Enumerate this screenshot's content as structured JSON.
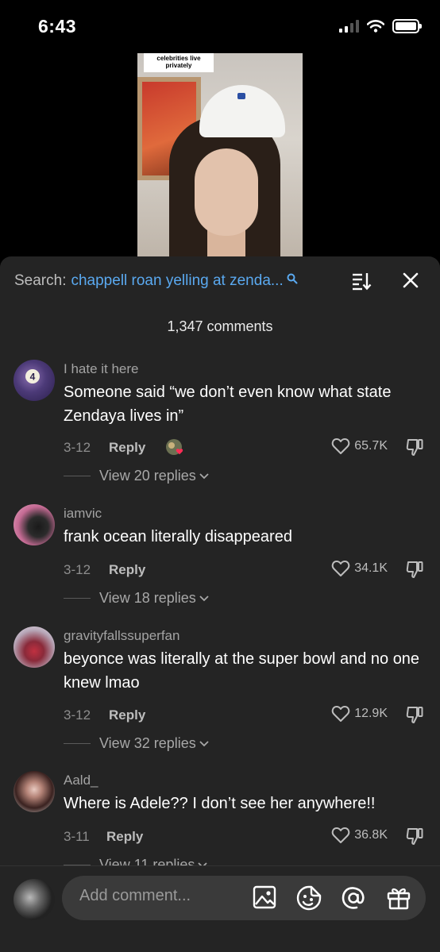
{
  "status_bar": {
    "time": "6:43"
  },
  "video": {
    "caption": "celebrities live privately"
  },
  "search": {
    "label": "Search:",
    "query": "chappell roan yelling at zenda..."
  },
  "comment_count": "1,347 comments",
  "comments": [
    {
      "username": "I hate it here",
      "text": "Someone said “we don’t even know what state Zendaya lives in”",
      "date": "3-12",
      "reply": "Reply",
      "likes": "65.7K",
      "view_replies": "View 20 replies",
      "creator_liked": true
    },
    {
      "username": "iamvic",
      "text": "frank ocean literally disappeared",
      "date": "3-12",
      "reply": "Reply",
      "likes": "34.1K",
      "view_replies": "View 18 replies"
    },
    {
      "username": "gravityfallssuperfan",
      "text": "beyonce was literally at the super bowl and no one knew lmao",
      "date": "3-12",
      "reply": "Reply",
      "likes": "12.9K",
      "view_replies": "View 32 replies"
    },
    {
      "username": "Aald_",
      "text": "Where is Adele?? I don’t see her anywhere!!",
      "date": "3-11",
      "reply": "Reply",
      "likes": "36.8K",
      "view_replies": "View 11 replies"
    }
  ],
  "comment_input": {
    "placeholder": "Add comment..."
  },
  "icons": {
    "search": "search-icon",
    "sort": "sort-icon",
    "close": "close-icon",
    "like": "heart-icon",
    "dislike": "thumbs-down-icon",
    "image": "image-icon",
    "emoji": "sticker-icon",
    "mention": "at-icon",
    "gift": "gift-icon"
  },
  "colors": {
    "panel": "#242424",
    "link": "#5aa9f0",
    "creator_heart": "#ff2d55"
  }
}
